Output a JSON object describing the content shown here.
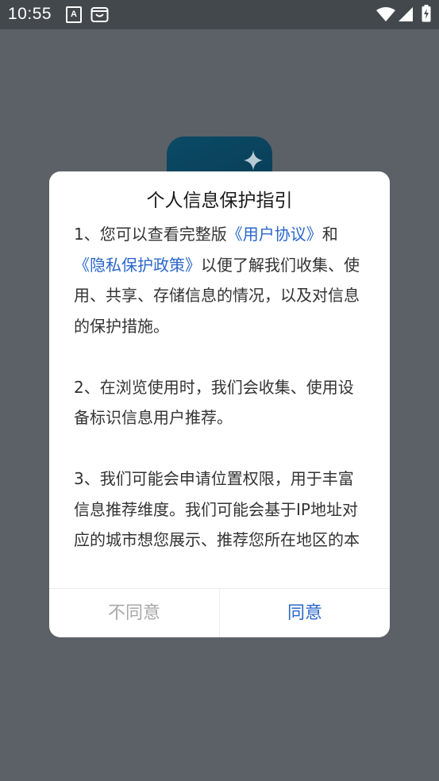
{
  "status_bar": {
    "time": "10:55",
    "icons": [
      "text-a-icon",
      "store-icon",
      "wifi-icon",
      "signal-icon",
      "battery-charging-icon"
    ],
    "text_a": "A"
  },
  "background_app": {
    "icon": "sparkle-icon",
    "icon_color": "#0b4a66"
  },
  "dialog": {
    "title": "个人信息保护指引",
    "p1": {
      "prefix": "1、您可以查看完整版",
      "link_user_agreement": "《用户协议》",
      "and": "和",
      "link_privacy_policy": "《隐私保护政策》",
      "suffix": "以便了解我们收集、使用、共享、存储信息的情况，以及对信息的保护措施。"
    },
    "p2": "2、在浏览使用时，我们会收集、使用设备标识信息用户推荐。",
    "p3": "3、我们可能会申请位置权限，用于丰富信息推荐维度。我们可能会基于IP地址对应的城市想您展示、推荐您所在地区的本地相关信息或内容，城市位置无",
    "buttons": {
      "disagree": "不同意",
      "agree": "同意"
    },
    "colors": {
      "link": "#2a67c9",
      "disabled_text": "#a8a8a8",
      "overlay": "#5b6167"
    }
  }
}
